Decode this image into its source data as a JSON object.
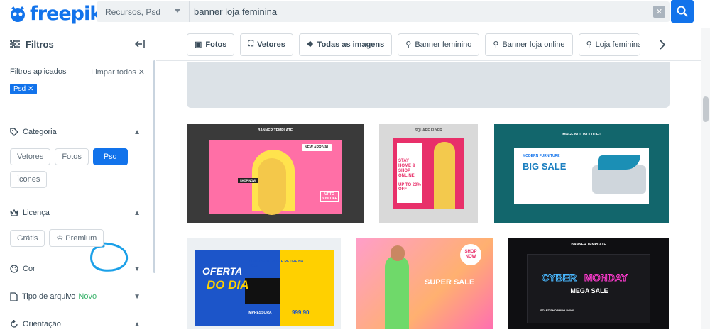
{
  "header": {
    "logo_text": "freepik",
    "search_category": "Recursos, Psd",
    "search_value": "banner loja feminina",
    "brand_color": "#1273eb"
  },
  "sidebar": {
    "title": "Filtros",
    "applied_label": "Filtros aplicados",
    "clear_label": "Limpar todos",
    "applied_chip": "Psd",
    "category": {
      "title": "Categoria",
      "options": [
        "Vetores",
        "Fotos",
        "Psd",
        "Ícones"
      ],
      "selected": "Psd"
    },
    "license": {
      "title": "Licença",
      "options": [
        "Grátis",
        "Premium"
      ]
    },
    "color": {
      "title": "Cor"
    },
    "file_type": {
      "title": "Tipo de arquivo",
      "badge": "Novo"
    },
    "orientation": {
      "title": "Orientação"
    }
  },
  "tags": [
    {
      "label": "Fotos",
      "icon": "photo-icon"
    },
    {
      "label": "Vetores",
      "icon": "vector-icon"
    },
    {
      "label": "Todas as imagens",
      "icon": "images-icon"
    },
    {
      "label": "Banner feminino",
      "icon": "search-icon"
    },
    {
      "label": "Banner loja online",
      "icon": "search-icon"
    },
    {
      "label": "Loja feminina",
      "icon": "search-icon"
    }
  ],
  "thumbs": {
    "t1": {
      "top": "BANNER TEMPLATE",
      "badge": "NEW ARRIVAL",
      "cta": "SHOP NOW",
      "promo": "UPTO 30% OFF"
    },
    "t2": {
      "top": "SQUARE FLYER",
      "line1": "STAY HOME & SHOP ONLINE",
      "promo": "UP TO 20% OFF"
    },
    "t3": {
      "top": "IMAGE NOT INCLUDED",
      "title": "BIG SALE",
      "sub": "MODERN FURNITURE"
    },
    "t4": {
      "line1": "OFERTA",
      "line2": "DO DIA",
      "side": "COMPRE NO SITE E RETIRE NA LOJA",
      "item": "IMPRESSORA",
      "price": "999,90"
    },
    "t5": {
      "badge": "SHOP NOW",
      "title": "SUPER SALE"
    },
    "t6": {
      "top": "BANNER TEMPLATE",
      "title1": "CYBER",
      "title2": "MONDAY",
      "sub": "MEGA SALE",
      "cta": "START SHOPPING NOW!"
    }
  }
}
